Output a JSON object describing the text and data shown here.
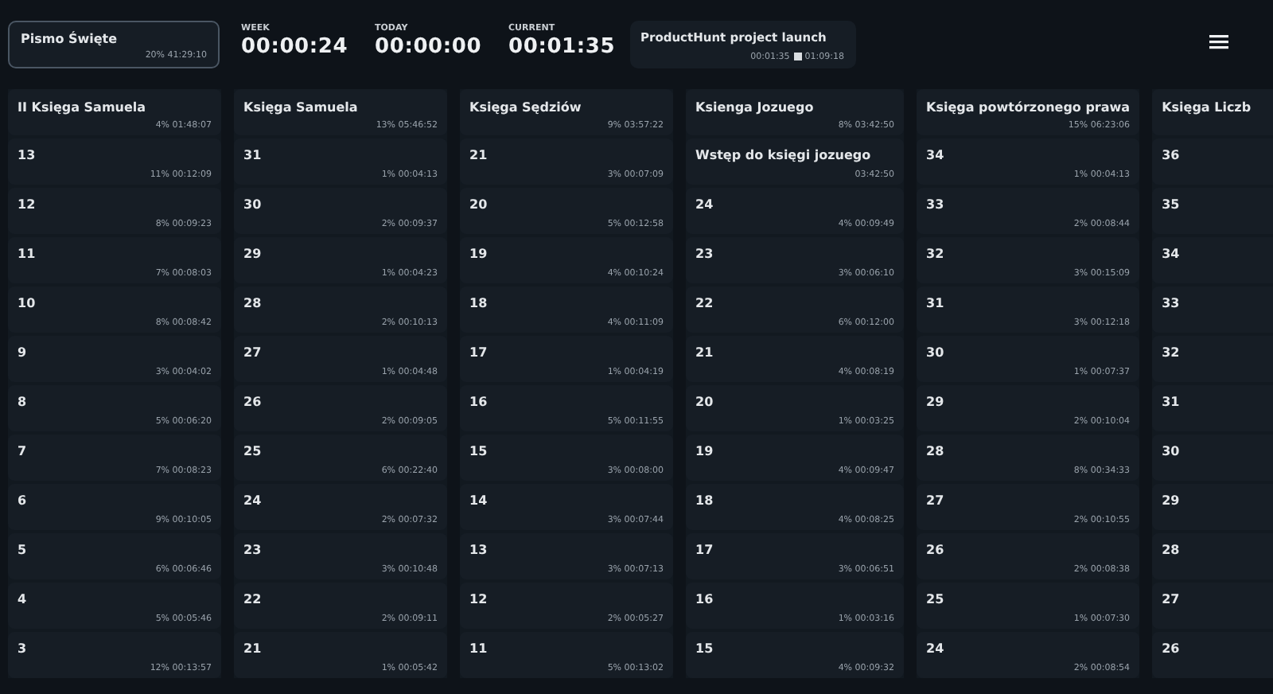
{
  "project": {
    "title": "Pismo Święte",
    "stats": "20% 41:29:10",
    "selected": true
  },
  "counters": [
    {
      "label": "WEEK",
      "value": "00:00:24"
    },
    {
      "label": "TODAY",
      "value": "00:00:00"
    },
    {
      "label": "CURRENT",
      "value": "00:01:35"
    }
  ],
  "active_task": {
    "title": "ProductHunt project launch",
    "elapsed": "00:01:35",
    "total": "01:09:18"
  },
  "columns": [
    {
      "title": "II Księga Samuela",
      "stats": "4% 01:48:07",
      "rows": [
        {
          "label": "13",
          "stats": "11% 00:12:09"
        },
        {
          "label": "12",
          "stats": "8% 00:09:23"
        },
        {
          "label": "11",
          "stats": "7% 00:08:03"
        },
        {
          "label": "10",
          "stats": "8% 00:08:42"
        },
        {
          "label": "9",
          "stats": "3% 00:04:02"
        },
        {
          "label": "8",
          "stats": "5% 00:06:20"
        },
        {
          "label": "7",
          "stats": "7% 00:08:23"
        },
        {
          "label": "6",
          "stats": "9% 00:10:05"
        },
        {
          "label": "5",
          "stats": "6% 00:06:46"
        },
        {
          "label": "4",
          "stats": "5% 00:05:46"
        },
        {
          "label": "3",
          "stats": "12% 00:13:57"
        }
      ]
    },
    {
      "title": "Księga Samuela",
      "stats": "13% 05:46:52",
      "rows": [
        {
          "label": "31",
          "stats": "1% 00:04:13"
        },
        {
          "label": "30",
          "stats": "2% 00:09:37"
        },
        {
          "label": "29",
          "stats": "1% 00:04:23"
        },
        {
          "label": "28",
          "stats": "2% 00:10:13"
        },
        {
          "label": "27",
          "stats": "1% 00:04:48"
        },
        {
          "label": "26",
          "stats": "2% 00:09:05"
        },
        {
          "label": "25",
          "stats": "6% 00:22:40"
        },
        {
          "label": "24",
          "stats": "2% 00:07:32"
        },
        {
          "label": "23",
          "stats": "3% 00:10:48"
        },
        {
          "label": "22",
          "stats": "2% 00:09:11"
        },
        {
          "label": "21",
          "stats": "1% 00:05:42"
        }
      ]
    },
    {
      "title": "Księga Sędziów",
      "stats": "9% 03:57:22",
      "rows": [
        {
          "label": "21",
          "stats": "3% 00:07:09"
        },
        {
          "label": "20",
          "stats": "5% 00:12:58"
        },
        {
          "label": "19",
          "stats": "4% 00:10:24"
        },
        {
          "label": "18",
          "stats": "4% 00:11:09"
        },
        {
          "label": "17",
          "stats": "1% 00:04:19"
        },
        {
          "label": "16",
          "stats": "5% 00:11:55"
        },
        {
          "label": "15",
          "stats": "3% 00:08:00"
        },
        {
          "label": "14",
          "stats": "3% 00:07:44"
        },
        {
          "label": "13",
          "stats": "3% 00:07:13"
        },
        {
          "label": "12",
          "stats": "2% 00:05:27"
        },
        {
          "label": "11",
          "stats": "5% 00:13:02"
        }
      ]
    },
    {
      "title": "Ksienga Jozuego",
      "stats": "8% 03:42:50",
      "rows": [
        {
          "label": "Wstęp do księgi jozuego",
          "stats": "03:42:50"
        },
        {
          "label": "24",
          "stats": "4% 00:09:49"
        },
        {
          "label": "23",
          "stats": "3% 00:06:10"
        },
        {
          "label": "22",
          "stats": "6% 00:12:00"
        },
        {
          "label": "21",
          "stats": "4% 00:08:19"
        },
        {
          "label": "20",
          "stats": "1% 00:03:25"
        },
        {
          "label": "19",
          "stats": "4% 00:09:47"
        },
        {
          "label": "18",
          "stats": "4% 00:08:25"
        },
        {
          "label": "17",
          "stats": "3% 00:06:51"
        },
        {
          "label": "16",
          "stats": "1% 00:03:16"
        },
        {
          "label": "15",
          "stats": "4% 00:09:32"
        }
      ]
    },
    {
      "title": "Księga powtórzonego prawa",
      "stats": "15% 06:23:06",
      "rows": [
        {
          "label": "34",
          "stats": "1% 00:04:13"
        },
        {
          "label": "33",
          "stats": "2% 00:08:44"
        },
        {
          "label": "32",
          "stats": "3% 00:15:09"
        },
        {
          "label": "31",
          "stats": "3% 00:12:18"
        },
        {
          "label": "30",
          "stats": "1% 00:07:37"
        },
        {
          "label": "29",
          "stats": "2% 00:10:04"
        },
        {
          "label": "28",
          "stats": "8% 00:34:33"
        },
        {
          "label": "27",
          "stats": "2% 00:10:55"
        },
        {
          "label": "26",
          "stats": "2% 00:08:38"
        },
        {
          "label": "25",
          "stats": "1% 00:07:30"
        },
        {
          "label": "24",
          "stats": "2% 00:08:54"
        }
      ]
    },
    {
      "title": "Księga Liczb",
      "rows": [
        {
          "label": "36"
        },
        {
          "label": "35"
        },
        {
          "label": "34"
        },
        {
          "label": "33"
        },
        {
          "label": "32"
        },
        {
          "label": "31"
        },
        {
          "label": "30"
        },
        {
          "label": "29"
        },
        {
          "label": "28"
        },
        {
          "label": "27"
        },
        {
          "label": "26"
        }
      ]
    }
  ]
}
